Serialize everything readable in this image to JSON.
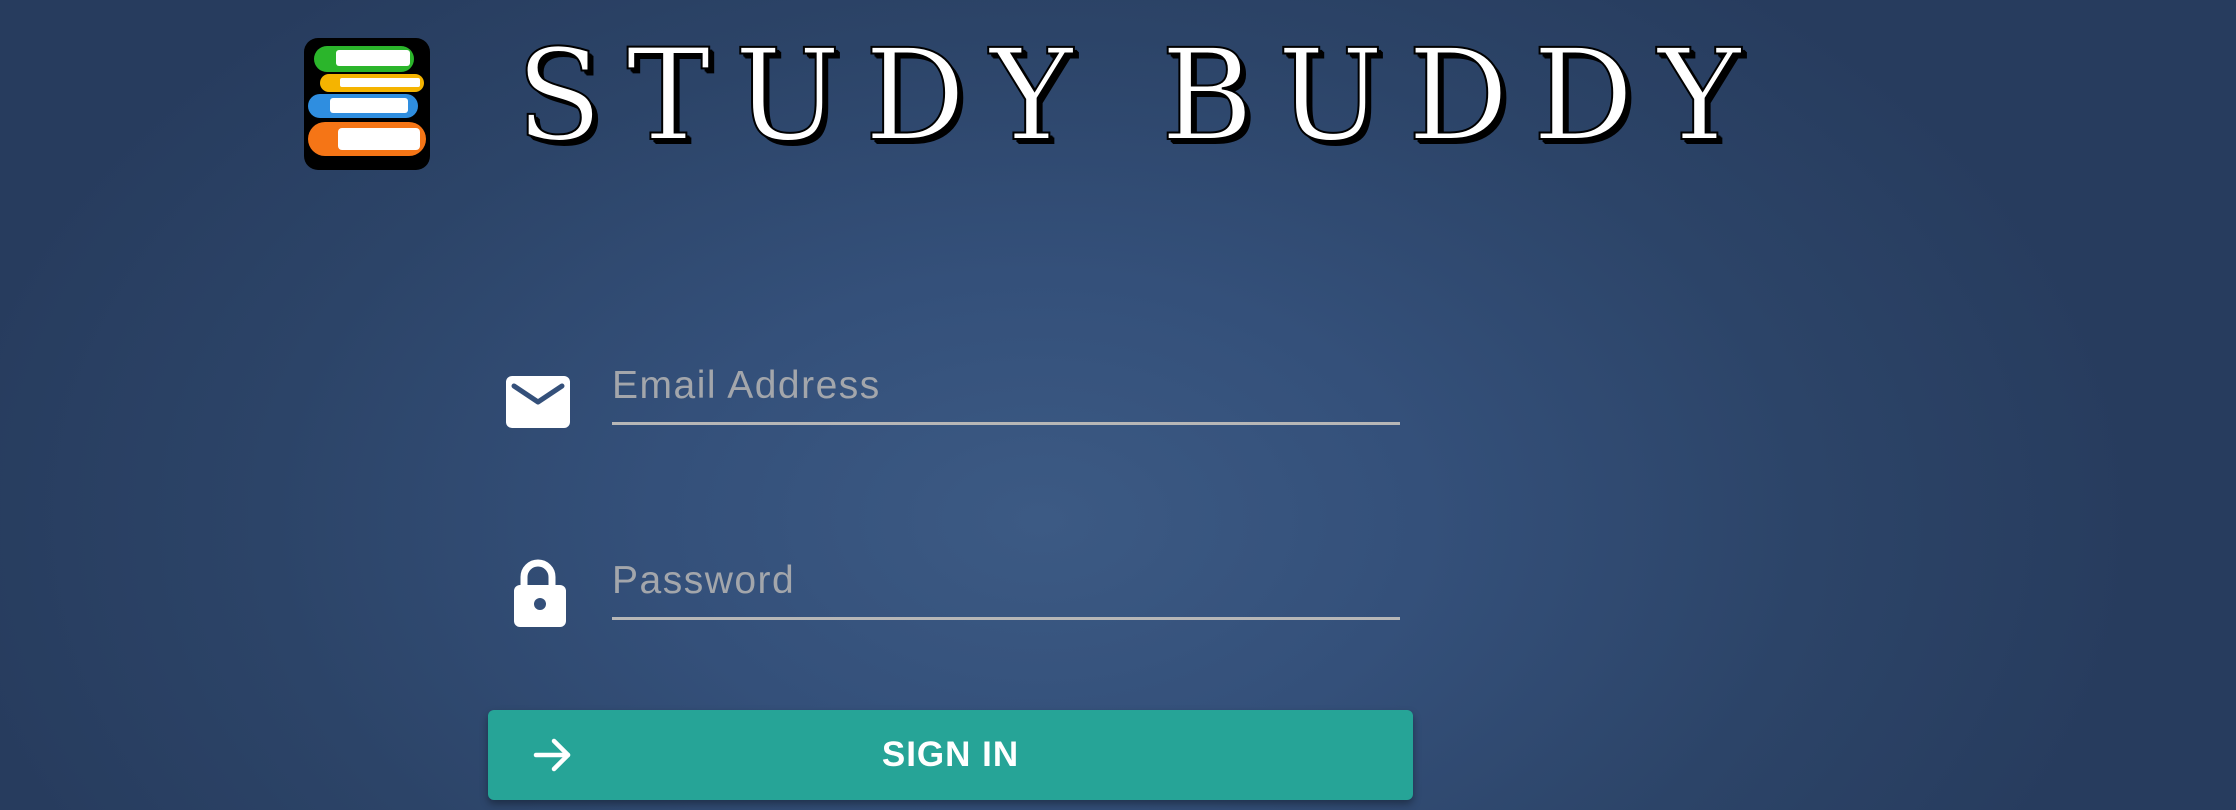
{
  "header": {
    "title": "STUDY BUDDY",
    "logo_icon": "books-stack-icon"
  },
  "form": {
    "email": {
      "icon": "envelope-icon",
      "placeholder": "Email Address",
      "value": ""
    },
    "password": {
      "icon": "lock-icon",
      "placeholder": "Password",
      "value": ""
    },
    "submit": {
      "icon": "arrow-right-icon",
      "label": "SIGN IN"
    }
  },
  "colors": {
    "background": "#34507a",
    "button": "#26a497",
    "input_underline": "#b7b7b7",
    "placeholder": "#a3a6ab"
  }
}
